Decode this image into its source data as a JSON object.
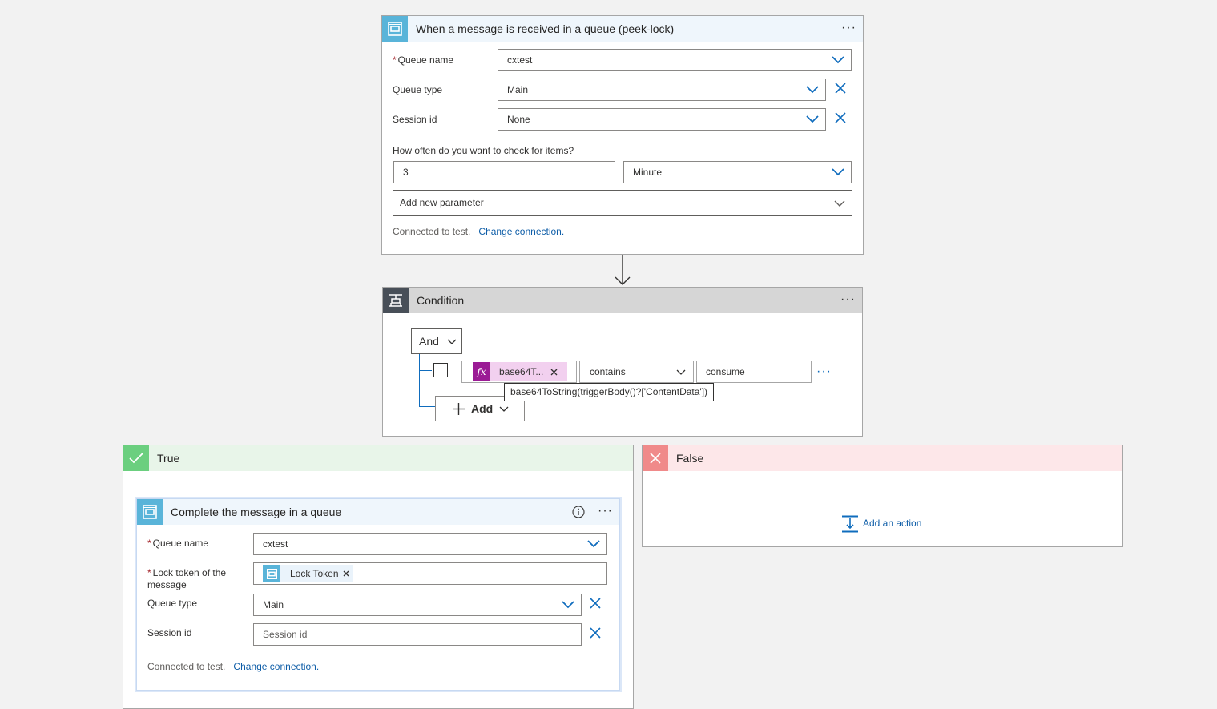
{
  "trigger": {
    "title": "When a message is received in a queue (peek-lock)",
    "more_label": "···",
    "queue_name_label": "Queue name",
    "queue_name_value": "cxtest",
    "queue_type_label": "Queue type",
    "queue_type_value": "Main",
    "session_id_label": "Session id",
    "session_id_value": "None",
    "interval_question": "How often do you want to check for items?",
    "interval_value": "3",
    "frequency_value": "Minute",
    "add_parameter_label": "Add new parameter",
    "connected_text": "Connected to test.",
    "change_connection": "Change connection."
  },
  "condition": {
    "title": "Condition",
    "more_label": "···",
    "group_operator": "And",
    "token_label": "base64T...",
    "token_tooltip": "base64ToString(triggerBody()?['ContentData'])",
    "operator_value": "contains",
    "compare_value": "consume",
    "row_more_label": "···",
    "add_label": "Add"
  },
  "true_branch": {
    "title": "True",
    "action": {
      "title": "Complete the message in a queue",
      "more_label": "···",
      "queue_name_label": "Queue name",
      "queue_name_value": "cxtest",
      "lock_token_label": "Lock token of the message",
      "lock_token_chip": "Lock Token",
      "queue_type_label": "Queue type",
      "queue_type_value": "Main",
      "session_id_label": "Session id",
      "session_id_placeholder": "Session id",
      "connected_text": "Connected to test.",
      "change_connection": "Change connection."
    }
  },
  "false_branch": {
    "title": "False",
    "add_action_label": "Add an action"
  },
  "colors": {
    "servicebus_icon": "#59b4d9",
    "condition_icon": "#484f58",
    "true_header": "#e8f5e9",
    "true_icon": "#6bcf7f",
    "false_header": "#fde7e9",
    "false_icon": "#f08a8a",
    "expression_token": "#9b1b95",
    "link": "#0f5ea8"
  }
}
